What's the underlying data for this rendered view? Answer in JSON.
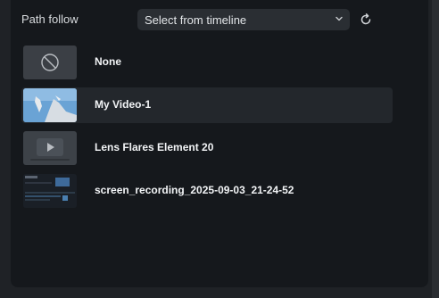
{
  "header": {
    "label": "Path follow",
    "dropdown_value": "Select from timeline",
    "dropdown_icon": "chevron-down-icon",
    "reset_icon": "reset-icon"
  },
  "items": [
    {
      "label": "None",
      "thumbnail": "none-icon",
      "selected": false
    },
    {
      "label": "My Video-1",
      "thumbnail": "video-thumbnail",
      "selected": true
    },
    {
      "label": "Lens Flares Element 20",
      "thumbnail": "play-icon",
      "selected": false
    },
    {
      "label": "screen_recording_2025-09-03_21-24-52",
      "thumbnail": "screen-recording-thumbnail",
      "selected": false
    }
  ],
  "colors": {
    "panel_bg": "#15181c",
    "outer_bg": "#1f2226",
    "selected_row_bg": "#23272c",
    "dropdown_bg": "#2a2e33",
    "text": "#f2f4f6"
  }
}
